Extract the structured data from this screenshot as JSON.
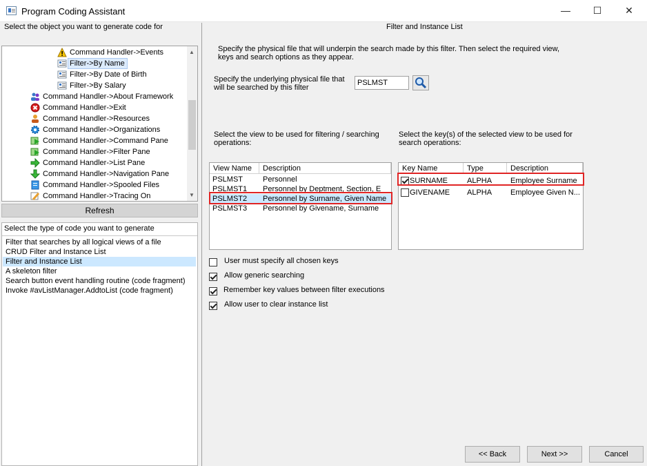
{
  "window": {
    "title": "Program Coding Assistant",
    "minimize": "—",
    "maximize": "☐",
    "close": "✕"
  },
  "left": {
    "object_prompt": "Select the object you want to generate code for",
    "tree": [
      {
        "label": "Command Handler->Events",
        "icon": "warning-icon"
      },
      {
        "label": "Filter->By Name",
        "icon": "filter-icon"
      },
      {
        "label": "Filter->By Date of Birth",
        "icon": "filter-icon"
      },
      {
        "label": "Filter->By Salary",
        "icon": "filter-icon"
      },
      {
        "label": "Command Handler->About Framework",
        "icon": "users-icon"
      },
      {
        "label": "Command Handler->Exit",
        "icon": "exit-icon"
      },
      {
        "label": "Command Handler->Resources",
        "icon": "person-icon"
      },
      {
        "label": "Command Handler->Organizations",
        "icon": "gear-icon"
      },
      {
        "label": "Command Handler->Command Pane",
        "icon": "pane-icon"
      },
      {
        "label": "Command Handler->Filter Pane",
        "icon": "pane-icon"
      },
      {
        "label": "Command Handler->List Pane",
        "icon": "arrow-right-icon"
      },
      {
        "label": "Command Handler->Navigation Pane",
        "icon": "arrow-down-icon"
      },
      {
        "label": "Command Handler->Spooled Files",
        "icon": "document-icon"
      },
      {
        "label": "Command Handler->Tracing On",
        "icon": "pencil-icon"
      }
    ],
    "refresh_label": "Refresh",
    "code_prompt": "Select the type of code you want to generate",
    "code_types": [
      "Filter that searches by all logical views of a file",
      "CRUD Filter and Instance List",
      "Filter and Instance List",
      "A skeleton filter",
      "Search button event handling routine (code fragment)",
      "Invoke #avListManager.AddtoList (code fragment)"
    ]
  },
  "right": {
    "heading": "Filter and Instance List",
    "intro": [
      "Specify the physical file that will underpin the search made by this filter. Then select the required view,",
      "keys and search options as they appear."
    ],
    "file_prompt": [
      "Specify the underlying physical file that",
      "will be searched by this filter"
    ],
    "file_value": "PSLMST",
    "view_prompt": [
      "Select the view to be used for filtering / searching",
      "operations:"
    ],
    "key_prompt": [
      "Select the key(s) of the selected view to be used for",
      "search operations:"
    ],
    "views": {
      "headers": [
        "View Name",
        "Description"
      ],
      "rows": [
        [
          "PSLMST",
          "Personnel"
        ],
        [
          "PSLMST1",
          "Personnel by Deptment, Section, E"
        ],
        [
          "PSLMST2",
          "Personnel by Surname, Given Name"
        ],
        [
          "PSLMST3",
          "Personnel by Givename, Surname"
        ]
      ]
    },
    "keys": {
      "headers": [
        "Key Name",
        "Type",
        "Description"
      ],
      "rows": [
        [
          "SURNAME",
          "ALPHA",
          "Employee Surname"
        ],
        [
          "GIVENAME",
          "ALPHA",
          "Employee Given N..."
        ]
      ]
    },
    "options": [
      {
        "label": "User must specify all chosen keys",
        "checked": false
      },
      {
        "label": "Allow generic searching",
        "checked": true
      },
      {
        "label": "Remember key values between filter executions",
        "checked": true
      },
      {
        "label": "Allow user to clear instance list",
        "checked": true
      }
    ],
    "buttons": {
      "back": "<< Back",
      "next": "Next >>",
      "cancel": "Cancel"
    }
  }
}
